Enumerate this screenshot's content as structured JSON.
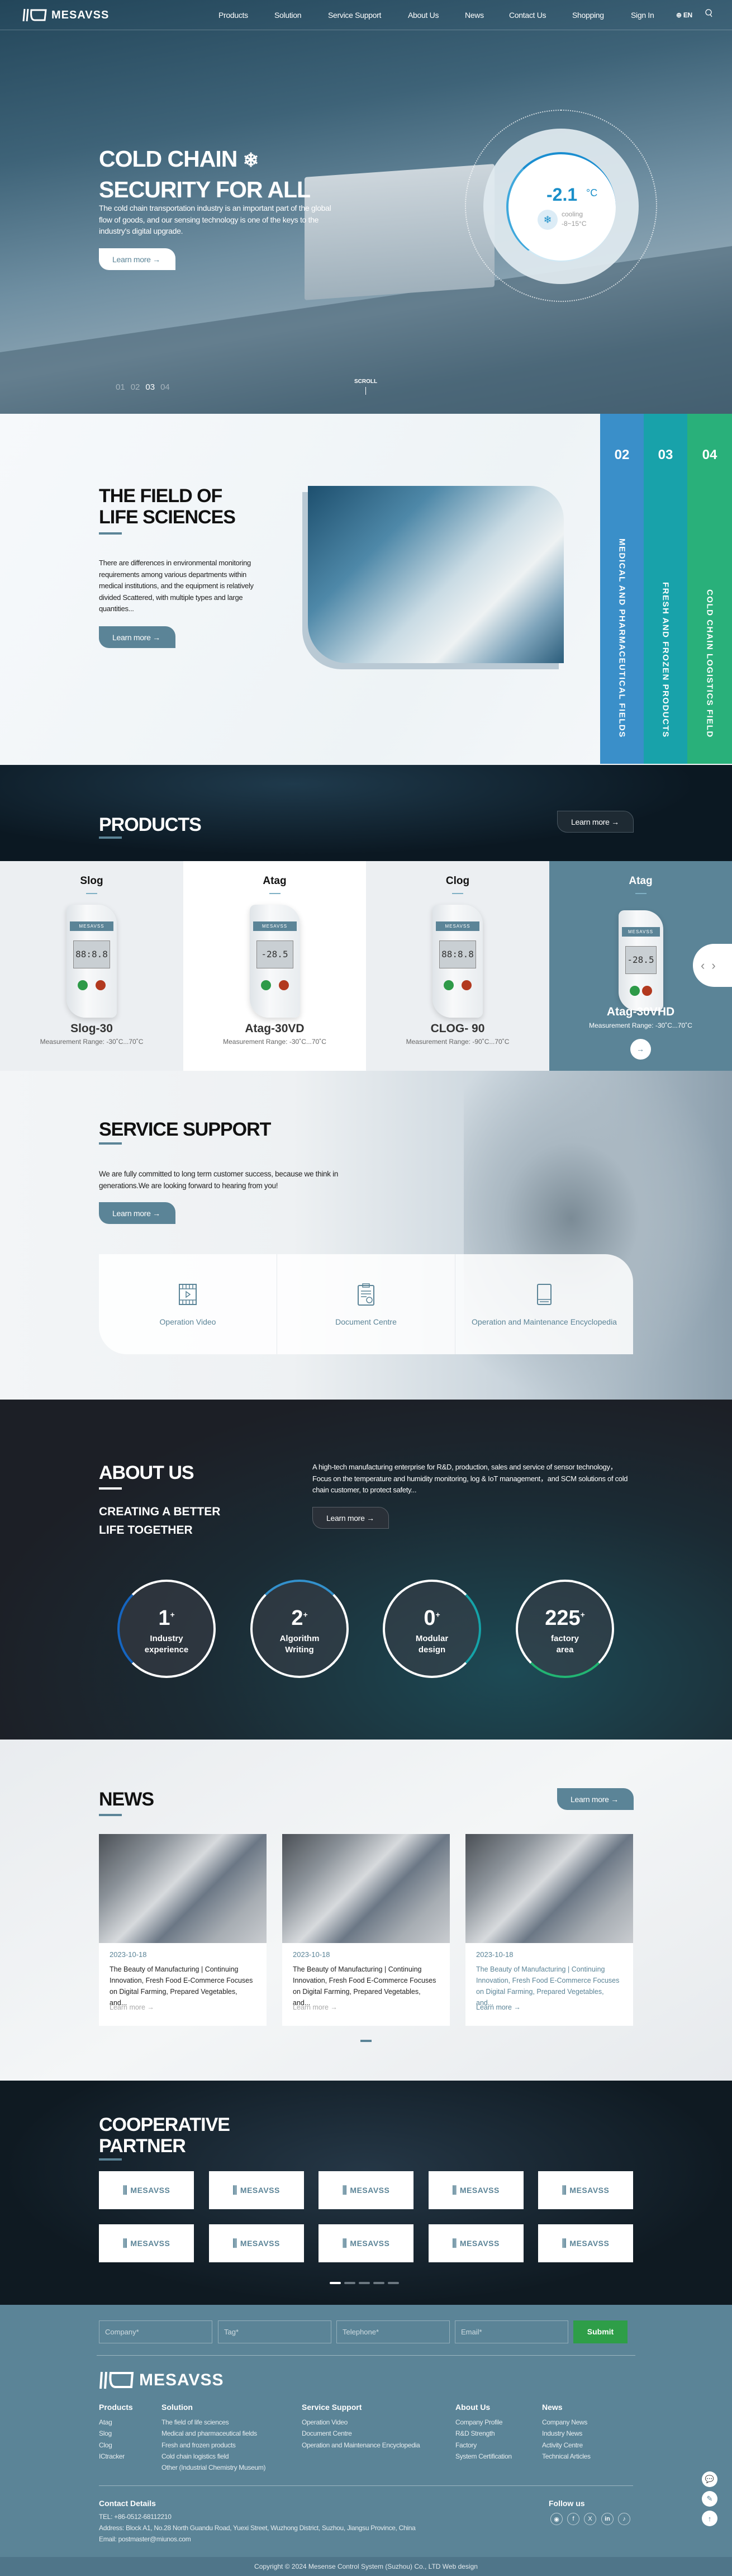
{
  "brand": {
    "name": "MESAVSS",
    "accent": "#5b8497"
  },
  "nav": {
    "items": [
      "Products",
      "Solution",
      "Service Support",
      "About Us",
      "News",
      "Contact Us",
      "Shopping",
      "Sign In"
    ],
    "lang": "EN"
  },
  "hero": {
    "title_line1": "COLD CHAIN",
    "title_line2": "SECURITY FOR ALL",
    "text": "The cold chain transportation industry is an important part of the global flow of goods, and our sensing technology is one of the keys to the industry's digital upgrade.",
    "button": "Learn more →",
    "gauge": {
      "value": "-2.1",
      "unit": "°C",
      "mode": "cooling",
      "range": "-8~15°C"
    },
    "slides": [
      "01",
      "02",
      "03",
      "04"
    ],
    "active_slide": "03",
    "scroll": "SCROLL"
  },
  "fields": {
    "title_line1": "THE FIELD OF",
    "title_line2": "LIFE SCIENCES",
    "text": "There are differences in environmental monitoring requirements among various departments within medical institutions, and the equipment is relatively divided Scattered, with multiple types and large quantities...",
    "button": "Learn more →",
    "tabs": [
      {
        "num": "02",
        "label": "MEDICAL AND PHARMACEUTICAL FIELDS",
        "color": "#3a8fc9"
      },
      {
        "num": "03",
        "label": "FRESH AND FROZEN PRODUCTS",
        "color": "#18a2aa"
      },
      {
        "num": "04",
        "label": "COLD CHAIN LOGISTICS FIELD",
        "color": "#29b07a"
      }
    ]
  },
  "products": {
    "title": "PRODUCTS",
    "button": "Learn more →",
    "items": [
      {
        "category": "Slog",
        "model": "Slog-30",
        "range": "Measurement Range: -30˚C...70˚C",
        "lcd": "88:8.8"
      },
      {
        "category": "Atag",
        "model": "Atag-30VD",
        "range": "Measurement Range: -30˚C...70˚C",
        "lcd": "-28.5"
      },
      {
        "category": "Clog",
        "model": "CLOG- 90",
        "range": "Measurement Range: -90˚C...70˚C",
        "lcd": "88:8.8"
      },
      {
        "category": "Atag",
        "model": "Atag-30VHD",
        "range": "Measurement Range: -30˚C...70˚C",
        "lcd": "-28.5"
      }
    ],
    "device_brand": "MESAVSS",
    "arrow": "→",
    "prev": "‹",
    "next": "›"
  },
  "service": {
    "title": "SERVICE SUPPORT",
    "text": "We are fully committed to long term customer success, because we think in generations.We are looking forward to hearing from you!",
    "button": "Learn more →",
    "items": [
      "Operation Video",
      "Document Centre",
      "Operation and Maintenance Encyclopedia"
    ]
  },
  "about": {
    "title": "ABOUT US",
    "subtitle_line1": "CREATING A BETTER",
    "subtitle_line2": "LIFE TOGETHER",
    "text": "A high-tech manufacturing enterprise for R&D, production, sales and service of sensor technology，Focus on the temperature and humidity monitoring, log & IoT management，and SCM solutions of cold chain customer, to protect safety...",
    "button": "Learn more →",
    "stats": [
      {
        "value": "1",
        "sup": "+",
        "label_line1": "Industry",
        "label_line2": "experience",
        "color": "#1565c0"
      },
      {
        "value": "2",
        "sup": "+",
        "label_line1": "Algorithm",
        "label_line2": "Writing",
        "color": "#3391cc"
      },
      {
        "value": "0",
        "sup": "+",
        "label_line1": "Modular",
        "label_line2": "design",
        "color": "#15a3a8"
      },
      {
        "value": "225",
        "sup": "+",
        "label_line1": "factory",
        "label_line2": "area",
        "color": "#22b573"
      }
    ]
  },
  "news": {
    "title": "NEWS",
    "button": "Learn more →",
    "items": [
      {
        "date": "2023-10-18",
        "title": "The Beauty of Manufacturing | Continuing Innovation, Fresh Food E-Commerce Focuses on Digital Farming, Prepared Vegetables, and...",
        "link": "Learn more →"
      },
      {
        "date": "2023-10-18",
        "title": "The Beauty of Manufacturing | Continuing Innovation, Fresh Food E-Commerce Focuses on Digital Farming, Prepared Vegetables, and...",
        "link": "Learn more →"
      },
      {
        "date": "2023-10-18",
        "title": "The Beauty of Manufacturing | Continuing Innovation, Fresh Food E-Commerce Focuses on Digital Farming, Prepared Vegetables, and...",
        "link": "Learn more →"
      }
    ]
  },
  "partners": {
    "title_line1": "COOPERATIVE",
    "title_line2": "PARTNER",
    "logos": [
      "MESAVSS",
      "MESAVSS",
      "MESAVSS",
      "MESAVSS",
      "MESAVSS",
      "MESAVSS",
      "MESAVSS",
      "MESAVSS",
      "MESAVSS",
      "MESAVSS"
    ],
    "pages": 5,
    "active_page": 1
  },
  "footer": {
    "form": {
      "company": "Company*",
      "tag": "Tag*",
      "telephone": "Telephone*",
      "email": "Email*",
      "submit": "Submit",
      "submit_color": "#2e9e48"
    },
    "columns": [
      {
        "title": "Products",
        "links": [
          "Atag",
          "Slog",
          "Clog",
          "ICtracker"
        ]
      },
      {
        "title": "Solution",
        "links": [
          "The field of life sciences",
          "Medical and pharmaceutical fields",
          "Fresh and frozen products",
          "Cold chain logistics field",
          "Other (Industrial Chemistry Museum)"
        ]
      },
      {
        "title": "Service Support",
        "links": [
          "Operation Video",
          "Document Centre",
          "Operation and Maintenance Encyclopedia"
        ]
      },
      {
        "title": "About Us",
        "links": [
          "Company Profile",
          "R&D Strength",
          "Factory",
          "System Certification"
        ]
      },
      {
        "title": "News",
        "links": [
          "Company News",
          "Industry News",
          "Activity Centre",
          "Technical Articles"
        ]
      }
    ],
    "contact": {
      "title": "Contact Details",
      "tel": "TEL: +86-0512-68112210",
      "address": "Address: Block A1, No.28 North Guandu Road, Yuexi Street, Wuzhong District, Suzhou, Jiangsu Province, China",
      "email": "Email: postmaster@miunos.com"
    },
    "follow": {
      "title": "Follow us",
      "icons": [
        "weibo-icon",
        "facebook-icon",
        "x-icon",
        "linkedin-icon",
        "tiktok-icon"
      ]
    },
    "copyright": "Copyright © 2024 Mesense Control System (Suzhou) Co., LTD Web design"
  }
}
